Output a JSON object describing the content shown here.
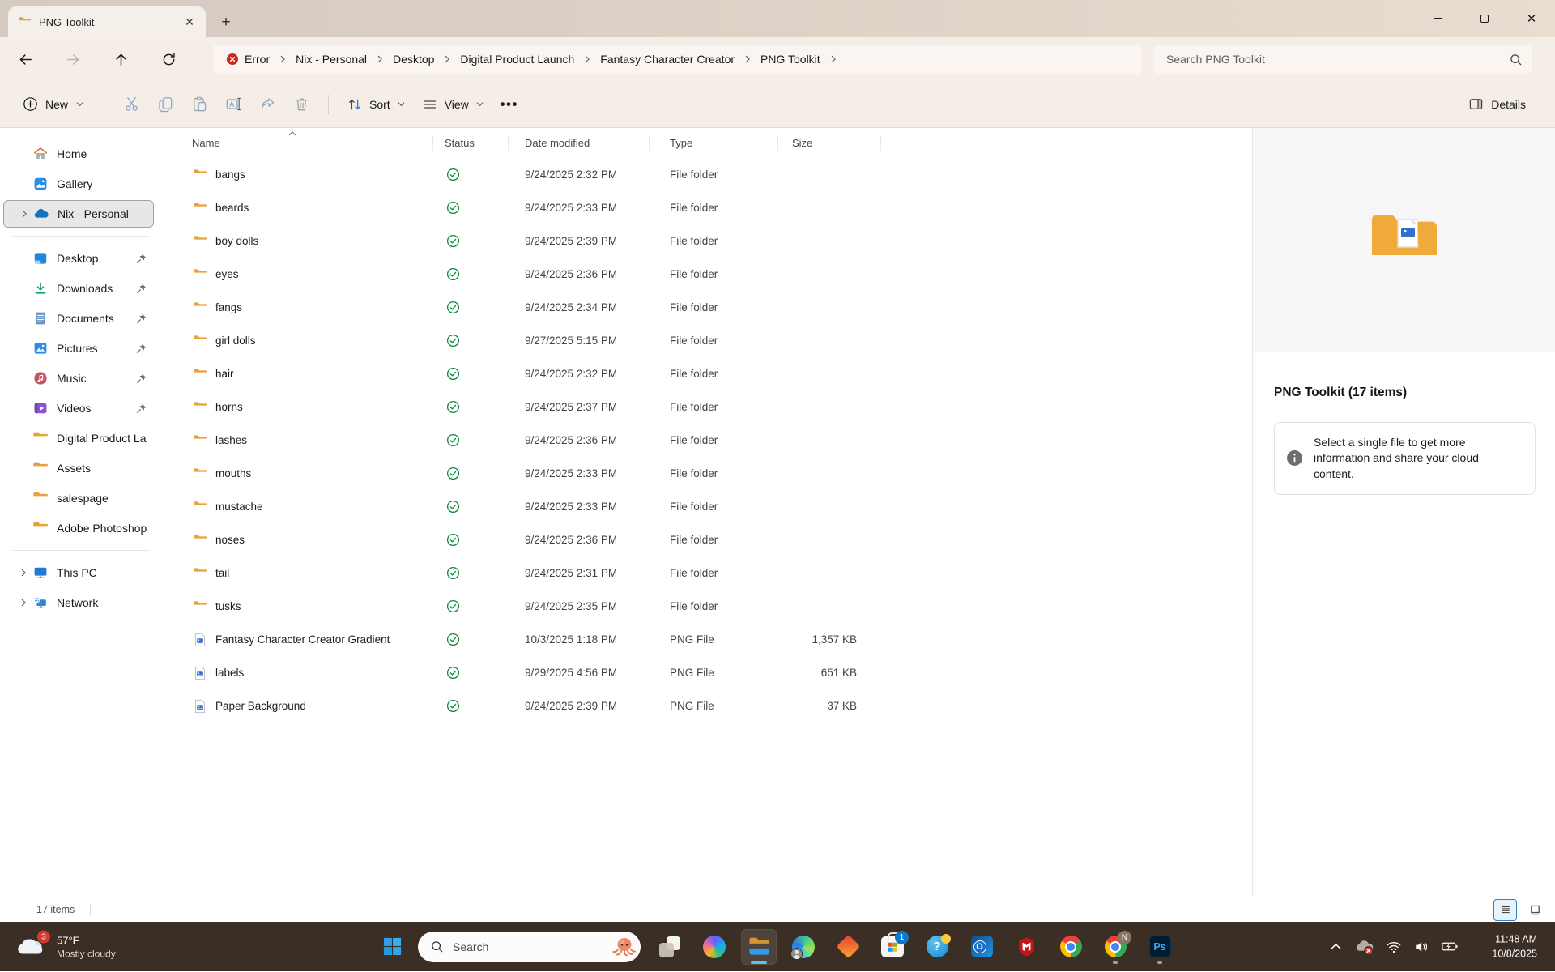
{
  "window": {
    "tab_title": "PNG Toolkit"
  },
  "navbar": {
    "breadcrumbs": [
      {
        "label": "Error",
        "icon": "error-icon"
      },
      {
        "label": "Nix - Personal"
      },
      {
        "label": "Desktop"
      },
      {
        "label": "Digital Product Launch"
      },
      {
        "label": "Fantasy Character Creator"
      },
      {
        "label": "PNG Toolkit"
      }
    ],
    "search_placeholder": "Search PNG Toolkit"
  },
  "toolbar": {
    "new_label": "New",
    "sort_label": "Sort",
    "view_label": "View",
    "details_label": "Details"
  },
  "sidebar": {
    "items": [
      {
        "label": "Home",
        "icon": "home-icon"
      },
      {
        "label": "Gallery",
        "icon": "gallery-icon"
      },
      {
        "label": "Nix - Personal",
        "icon": "onedrive-icon",
        "selected": true,
        "expandable": true,
        "sep_after": true
      },
      {
        "label": "Desktop",
        "icon": "desktop-icon",
        "pinned": true
      },
      {
        "label": "Downloads",
        "icon": "downloads-icon",
        "pinned": true
      },
      {
        "label": "Documents",
        "icon": "documents-icon",
        "pinned": true
      },
      {
        "label": "Pictures",
        "icon": "pictures-icon",
        "pinned": true
      },
      {
        "label": "Music",
        "icon": "music-icon",
        "pinned": true
      },
      {
        "label": "Videos",
        "icon": "videos-icon",
        "pinned": true
      },
      {
        "label": "Digital Product Lau",
        "icon": "folder-icon"
      },
      {
        "label": "Assets",
        "icon": "folder-icon"
      },
      {
        "label": "salespage",
        "icon": "folder-icon"
      },
      {
        "label": "Adobe Photoshop",
        "icon": "folder-icon",
        "sep_after": true
      },
      {
        "label": "This PC",
        "icon": "thispc-icon",
        "expandable": true
      },
      {
        "label": "Network",
        "icon": "network-icon",
        "expandable": true
      }
    ]
  },
  "files": {
    "columns": [
      "Name",
      "Status",
      "Date modified",
      "Type",
      "Size"
    ],
    "rows": [
      {
        "name": "bangs",
        "icon": "folder-icon",
        "status": "synced",
        "date": "9/24/2025 2:32 PM",
        "type": "File folder",
        "size": ""
      },
      {
        "name": "beards",
        "icon": "folder-icon",
        "status": "synced",
        "date": "9/24/2025 2:33 PM",
        "type": "File folder",
        "size": ""
      },
      {
        "name": "boy dolls",
        "icon": "folder-icon",
        "status": "synced",
        "date": "9/24/2025 2:39 PM",
        "type": "File folder",
        "size": ""
      },
      {
        "name": "eyes",
        "icon": "folder-icon",
        "status": "synced",
        "date": "9/24/2025 2:36 PM",
        "type": "File folder",
        "size": ""
      },
      {
        "name": "fangs",
        "icon": "folder-icon",
        "status": "synced",
        "date": "9/24/2025 2:34 PM",
        "type": "File folder",
        "size": ""
      },
      {
        "name": "girl dolls",
        "icon": "folder-icon",
        "status": "synced",
        "date": "9/27/2025 5:15 PM",
        "type": "File folder",
        "size": ""
      },
      {
        "name": "hair",
        "icon": "folder-icon",
        "status": "synced",
        "date": "9/24/2025 2:32 PM",
        "type": "File folder",
        "size": ""
      },
      {
        "name": "horns",
        "icon": "folder-icon",
        "status": "synced",
        "date": "9/24/2025 2:37 PM",
        "type": "File folder",
        "size": ""
      },
      {
        "name": "lashes",
        "icon": "folder-icon",
        "status": "synced",
        "date": "9/24/2025 2:36 PM",
        "type": "File folder",
        "size": ""
      },
      {
        "name": "mouths",
        "icon": "folder-icon",
        "status": "synced",
        "date": "9/24/2025 2:33 PM",
        "type": "File folder",
        "size": ""
      },
      {
        "name": "mustache",
        "icon": "folder-icon",
        "status": "synced",
        "date": "9/24/2025 2:33 PM",
        "type": "File folder",
        "size": ""
      },
      {
        "name": "noses",
        "icon": "folder-icon",
        "status": "synced",
        "date": "9/24/2025 2:36 PM",
        "type": "File folder",
        "size": ""
      },
      {
        "name": "tail",
        "icon": "folder-icon",
        "status": "synced",
        "date": "9/24/2025 2:31 PM",
        "type": "File folder",
        "size": ""
      },
      {
        "name": "tusks",
        "icon": "folder-icon",
        "status": "synced",
        "date": "9/24/2025 2:35 PM",
        "type": "File folder",
        "size": ""
      },
      {
        "name": "Fantasy Character Creator Gradient",
        "icon": "png-file-icon",
        "status": "synced",
        "date": "10/3/2025 1:18 PM",
        "type": "PNG File",
        "size": "1,357 KB"
      },
      {
        "name": "labels",
        "icon": "png-file-icon",
        "status": "synced",
        "date": "9/29/2025 4:56 PM",
        "type": "PNG File",
        "size": "651 KB"
      },
      {
        "name": "Paper Background",
        "icon": "png-file-icon",
        "status": "synced",
        "date": "9/24/2025 2:39 PM",
        "type": "PNG File",
        "size": "37 KB"
      }
    ]
  },
  "details_pane": {
    "title": "PNG Toolkit (17 items)",
    "message": "Select a single file to get more information and share your cloud content."
  },
  "statusbar": {
    "count": "17 items"
  },
  "taskbar": {
    "weather": {
      "badge": "3",
      "temp": "57°F",
      "condition": "Mostly cloudy"
    },
    "search_label": "Search",
    "apps": [
      {
        "name": "task-view",
        "icon": "taskview-icon"
      },
      {
        "name": "copilot",
        "icon": "copilot-icon"
      },
      {
        "name": "file-explorer",
        "icon": "explorer-icon",
        "active": true
      },
      {
        "name": "edge",
        "icon": "edge-icon"
      },
      {
        "name": "office-diamond",
        "icon": "diamond-icon"
      },
      {
        "name": "microsoft-store",
        "icon": "store-icon",
        "badge": "1"
      },
      {
        "name": "get-help",
        "icon": "help-icon",
        "glyph": "?"
      },
      {
        "name": "outlook",
        "icon": "outlook-icon",
        "glyph": "O"
      },
      {
        "name": "mcafee",
        "icon": "mcafee-icon"
      },
      {
        "name": "chrome",
        "icon": "chrome-icon"
      },
      {
        "name": "chrome-profile",
        "icon": "chrome-icon",
        "badge": "N",
        "running": true
      },
      {
        "name": "photoshop",
        "icon": "photoshop-icon",
        "glyph": "Ps",
        "running": true
      }
    ],
    "clock": {
      "time": "11:48 AM",
      "date": "10/8/2025"
    }
  }
}
